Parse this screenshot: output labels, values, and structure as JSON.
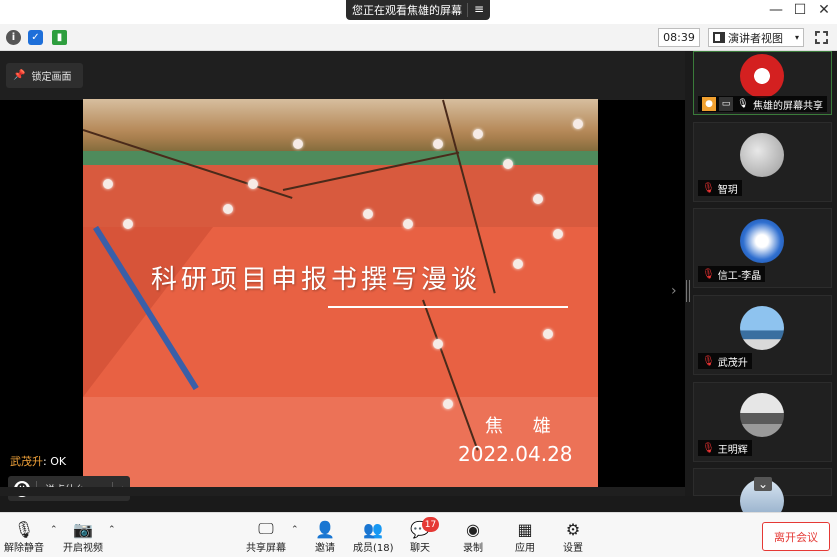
{
  "window": {
    "share_banner": "您正在观看焦雄的屏幕",
    "menu_icon": "≡",
    "minimize": "—",
    "maximize": "☐",
    "close": "✕"
  },
  "toolbar": {
    "time": "08:39",
    "view_label": "演讲者视图",
    "view_caret": "▾"
  },
  "stage": {
    "lock_label": "锁定画面"
  },
  "slide": {
    "title": "科研项目申报书撰写漫谈",
    "author": "焦 雄",
    "date": "2022.04.28"
  },
  "chat": {
    "sender": "武茂升",
    "message": "OK",
    "placeholder": "说点什么...",
    "collapse": "‹"
  },
  "participants": [
    {
      "name": "焦雄的屏幕共享",
      "muted": false
    },
    {
      "name": "智玥",
      "muted": true
    },
    {
      "name": "信工-李晶",
      "muted": true
    },
    {
      "name": "武茂升",
      "muted": true
    },
    {
      "name": "王明辉",
      "muted": true
    }
  ],
  "panel": {
    "expand": "›",
    "scroll_down": "⌄"
  },
  "bottom": {
    "unmute": "解除静音",
    "video": "开启视频",
    "share": "共享屏幕",
    "invite": "邀请",
    "members": "成员(18)",
    "chat": "聊天",
    "chat_badge": "17",
    "record": "录制",
    "apps": "应用",
    "settings": "设置",
    "leave": "离开会议"
  },
  "colors": {
    "accent_red": "#e53935",
    "active_green": "#3a7b3a",
    "chat_sender": "#f2a33a"
  }
}
